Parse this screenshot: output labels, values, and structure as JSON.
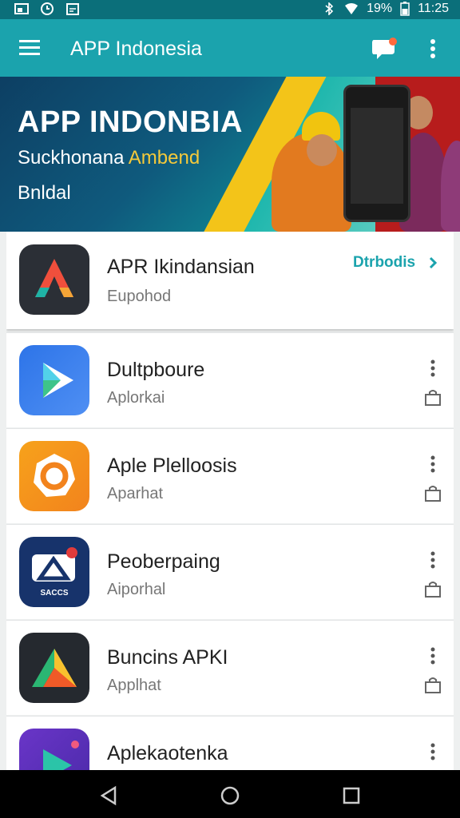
{
  "status_bar": {
    "battery_text": "19%",
    "time": "11:25"
  },
  "app_bar": {
    "title": "APP Indonesia"
  },
  "banner": {
    "headline": "APP INDONBIA",
    "subline_part1": "Suckhonana ",
    "subline_highlight": "Ambend",
    "subline2": "Bnldal"
  },
  "featured": {
    "name": "APR Ikindansian",
    "subtitle": "Eupohod",
    "action_label": "Dtrbodis"
  },
  "apps": [
    {
      "name": "Dultpboure",
      "subtitle": "Aplorkai",
      "icon": "play-arrow-icon"
    },
    {
      "name": "Aple Plelloosis",
      "subtitle": "Aparhat",
      "icon": "orange-gear-icon"
    },
    {
      "name": "Peoberpaing",
      "subtitle": "Aiporhal",
      "icon": "triangle-sign-icon",
      "icon_text": "SACCS"
    },
    {
      "name": "Buncins APKI",
      "subtitle": "Applhat",
      "icon": "drive-triangle-icon"
    },
    {
      "name": "Aplekaotenka",
      "subtitle": "",
      "icon": "purple-play-icon"
    }
  ],
  "colors": {
    "accent": "#1ba3ad",
    "status_bar": "#0b6f7a",
    "banner_yellow": "#f3c419"
  }
}
